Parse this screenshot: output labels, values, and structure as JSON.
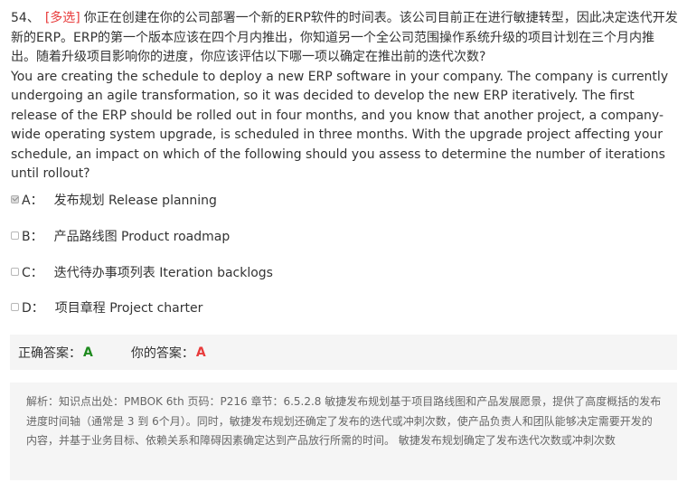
{
  "question": {
    "number": "54、",
    "tag": "[多选]",
    "text_cn": "你正在创建在你的公司部署一个新的ERP软件的时间表。该公司目前正在进行敏捷转型，因此决定迭代开发新的ERP。ERP的第一个版本应该在四个月内推出，你知道另一个全公司范围操作系统升级的项目计划在三个月内推出。随着升级项目影响你的进度，你应该评估以下哪一项以确定在推出前的迭代次数?",
    "text_en": "You are creating the schedule to deploy a new ERP software in your company. The company is currently undergoing an agile transformation, so it was decided to develop the new ERP iteratively. The first release of the ERP should be rolled out in four months, and you know that another project, a company-wide operating system upgrade, is scheduled in three months. With the upgrade project affecting your schedule, an impact on which of the following should you assess to determine the number of iterations until rollout?"
  },
  "options": [
    {
      "letter": "A：",
      "text": "发布规划 Release planning",
      "checked": true
    },
    {
      "letter": "B：",
      "text": "产品路线图 Product roadmap",
      "checked": false
    },
    {
      "letter": "C：",
      "text": "迭代待办事项列表 Iteration backlogs",
      "checked": false
    },
    {
      "letter": "D：",
      "text": "项目章程 Project charter",
      "checked": false
    }
  ],
  "answer": {
    "correct_label": "正确答案：",
    "correct_value": "A",
    "your_label": "你的答案：",
    "your_value": "A"
  },
  "analysis": {
    "text": "解析：知识点出处：PMBOK 6th 页码：P216 章节：6.5.2.8 敏捷发布规划基于项目路线图和产品发展愿景，提供了高度概括的发布进度时间轴（通常是 3 到 6个月）。同时，敏捷发布规划还确定了发布的迭代或冲刺次数，使产品负责人和团队能够决定需要开发的内容，并基于业务目标、依赖关系和障碍因素确定达到产品放行所需的时间。 敏捷发布规划确定了发布迭代次数或冲刺次数"
  },
  "colors": {
    "tag": "#e83b3b",
    "correct": "#1e8a1e",
    "yours": "#e83b3b",
    "panel_bg": "#f5f5f5"
  }
}
